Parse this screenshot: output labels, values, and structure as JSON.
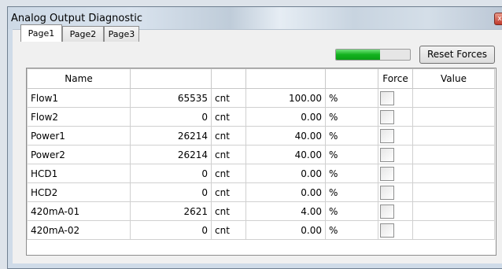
{
  "window": {
    "title": "Analog Output Diagnostic",
    "close_glyph": "x"
  },
  "tabs": [
    {
      "label": "Page1",
      "active": true
    },
    {
      "label": "Page2",
      "active": false
    },
    {
      "label": "Page3",
      "active": false
    }
  ],
  "progress": {
    "fraction": 0.6,
    "color": "#12b21e"
  },
  "reset_button": {
    "label": "Reset Forces"
  },
  "table": {
    "headers": [
      "Name",
      "",
      "",
      "",
      "",
      "Force",
      "Value"
    ],
    "rows": [
      {
        "name": "Flow1",
        "count": "65535",
        "count_unit": "cnt",
        "percent": "100.00",
        "percent_unit": "%",
        "force": false,
        "value": ""
      },
      {
        "name": "Flow2",
        "count": "0",
        "count_unit": "cnt",
        "percent": "0.00",
        "percent_unit": "%",
        "force": false,
        "value": ""
      },
      {
        "name": "Power1",
        "count": "26214",
        "count_unit": "cnt",
        "percent": "40.00",
        "percent_unit": "%",
        "force": false,
        "value": ""
      },
      {
        "name": "Power2",
        "count": "26214",
        "count_unit": "cnt",
        "percent": "40.00",
        "percent_unit": "%",
        "force": false,
        "value": ""
      },
      {
        "name": "HCD1",
        "count": "0",
        "count_unit": "cnt",
        "percent": "0.00",
        "percent_unit": "%",
        "force": false,
        "value": ""
      },
      {
        "name": "HCD2",
        "count": "0",
        "count_unit": "cnt",
        "percent": "0.00",
        "percent_unit": "%",
        "force": false,
        "value": ""
      },
      {
        "name": "420mA-01",
        "count": "2621",
        "count_unit": "cnt",
        "percent": "4.00",
        "percent_unit": "%",
        "force": false,
        "value": ""
      },
      {
        "name": "420mA-02",
        "count": "0",
        "count_unit": "cnt",
        "percent": "0.00",
        "percent_unit": "%",
        "force": false,
        "value": ""
      }
    ]
  }
}
